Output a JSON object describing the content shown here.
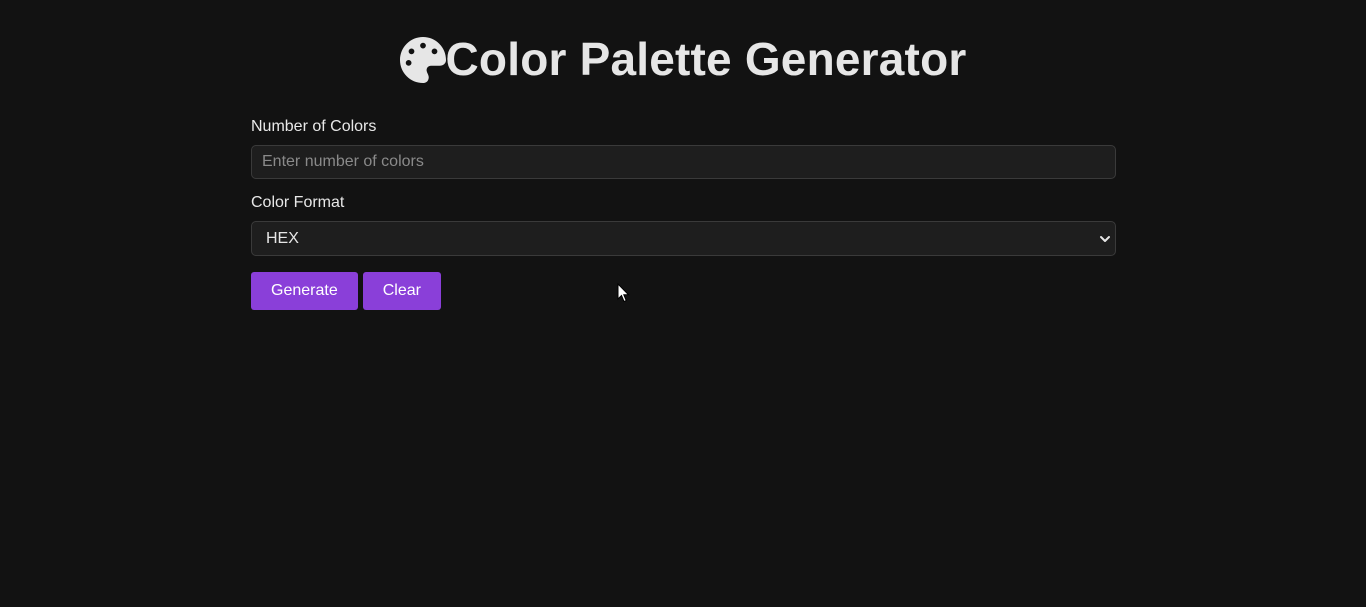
{
  "header": {
    "title": "Color Palette Generator",
    "icon": "palette-icon"
  },
  "form": {
    "count": {
      "label": "Number of Colors",
      "placeholder": "Enter number of colors",
      "value": ""
    },
    "format": {
      "label": "Color Format",
      "selected": "HEX"
    }
  },
  "buttons": {
    "generate_label": "Generate",
    "clear_label": "Clear"
  },
  "colors": {
    "background": "#121212",
    "accent": "#8a3fd9",
    "input_bg": "#1e1e1e",
    "text": "#e6e6e6"
  }
}
